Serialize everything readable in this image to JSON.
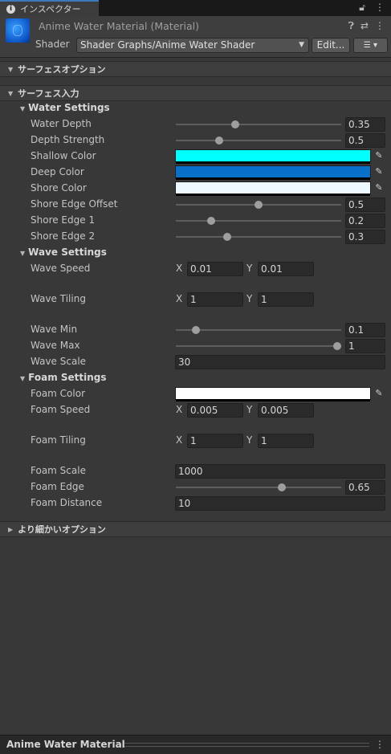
{
  "tab": {
    "icon": "info-icon",
    "title": "インスペクター",
    "lock_icon": "lock-icon",
    "more_icon": "kebab-icon"
  },
  "header": {
    "material_title": "Anime Water Material (Material)",
    "help_icon": "help-icon",
    "settings_icon": "sliders-icon",
    "more_icon": "kebab-icon",
    "shader_label": "Shader",
    "shader_value": "Shader Graphs/Anime Water Shader",
    "edit_label": "Edit...",
    "menu_label": "☰ ▾"
  },
  "sections": {
    "surface_options": "サーフェスオプション",
    "surface_inputs": "サーフェス入力",
    "advanced_options": "より細かいオプション"
  },
  "water": {
    "title": "Water Settings",
    "water_depth": {
      "label": "Water Depth",
      "value": "0.35",
      "fraction": 0.35
    },
    "depth_strength": {
      "label": "Depth Strength",
      "value": "0.5",
      "fraction": 0.25
    },
    "shallow_color": {
      "label": "Shallow Color",
      "color": "#00ffff"
    },
    "deep_color": {
      "label": "Deep Color",
      "color": "#0870c9"
    },
    "shore_color": {
      "label": "Shore Color",
      "color": "#eef8ff"
    },
    "shore_edge_offset": {
      "label": "Shore Edge Offset",
      "value": "0.5",
      "fraction": 0.5
    },
    "shore_edge_1": {
      "label": "Shore Edge 1",
      "value": "0.2",
      "fraction": 0.2
    },
    "shore_edge_2": {
      "label": "Shore Edge 2",
      "value": "0.3",
      "fraction": 0.3
    }
  },
  "wave": {
    "title": "Wave Settings",
    "wave_speed": {
      "label": "Wave Speed",
      "x": "0.01",
      "y": "0.01"
    },
    "wave_tiling": {
      "label": "Wave Tiling",
      "x": "1",
      "y": "1"
    },
    "wave_min": {
      "label": "Wave Min",
      "value": "0.1",
      "fraction": 0.1
    },
    "wave_max": {
      "label": "Wave Max",
      "value": "1",
      "fraction": 1.0
    },
    "wave_scale": {
      "label": "Wave Scale",
      "value": "30"
    }
  },
  "foam": {
    "title": "Foam Settings",
    "foam_color": {
      "label": "Foam Color",
      "color": "#ffffff"
    },
    "foam_speed": {
      "label": "Foam Speed",
      "x": "0.005",
      "y": "0.005"
    },
    "foam_tiling": {
      "label": "Foam Tiling",
      "x": "1",
      "y": "1"
    },
    "foam_scale": {
      "label": "Foam Scale",
      "value": "1000"
    },
    "foam_edge": {
      "label": "Foam Edge",
      "value": "0.65",
      "fraction": 0.65
    },
    "foam_distance": {
      "label": "Foam Distance",
      "value": "10"
    }
  },
  "axes": {
    "x": "X",
    "y": "Y"
  },
  "footer": {
    "name": "Anime Water Material"
  }
}
